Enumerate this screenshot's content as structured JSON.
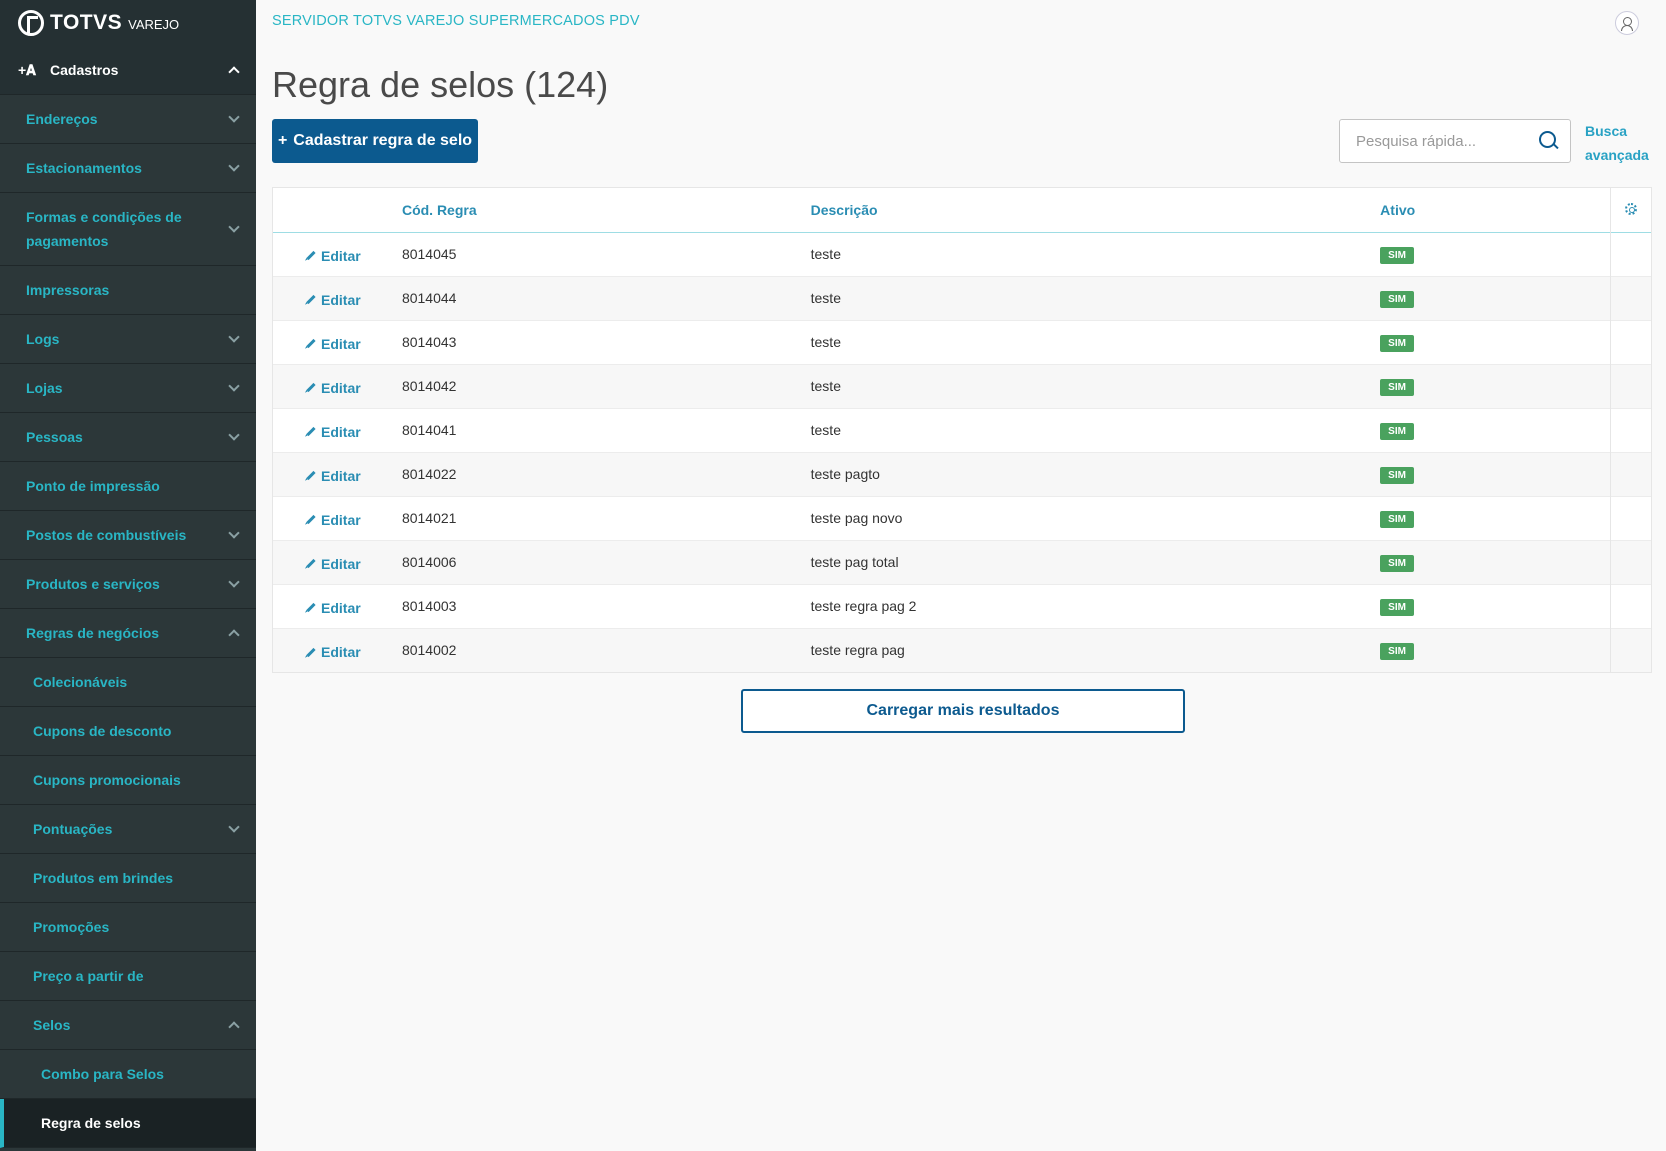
{
  "brand": {
    "name": "TOTVS",
    "product": "VAREJO"
  },
  "header": {
    "server_title": "SERVIDOR TOTVS VAREJO SUPERMERCADOS PDV"
  },
  "sidebar": {
    "section": "Cadastros",
    "items": [
      {
        "label": "Endereços"
      },
      {
        "label": "Estacionamentos"
      },
      {
        "label": "Formas e condições de pagamentos"
      },
      {
        "label": "Impressoras"
      },
      {
        "label": "Logs"
      },
      {
        "label": "Lojas"
      },
      {
        "label": "Pessoas"
      },
      {
        "label": "Ponto de impressão"
      },
      {
        "label": "Postos de combustíveis"
      },
      {
        "label": "Produtos e serviços"
      },
      {
        "label": "Regras de negócios"
      }
    ],
    "business_rules": [
      {
        "label": "Colecionáveis"
      },
      {
        "label": "Cupons de desconto"
      },
      {
        "label": "Cupons promocionais"
      },
      {
        "label": "Pontuações"
      },
      {
        "label": "Produtos em brindes"
      },
      {
        "label": "Promoções"
      },
      {
        "label": "Preço a partir de"
      },
      {
        "label": "Selos"
      }
    ],
    "selos": [
      {
        "label": "Combo para Selos"
      },
      {
        "label": "Regra de selos"
      }
    ]
  },
  "page": {
    "title": "Regra de selos (124)",
    "create_button": "Cadastrar regra de selo",
    "search_placeholder": "Pesquisa rápida...",
    "advanced_search": "Busca avançada",
    "load_more": "Carregar mais resultados"
  },
  "table": {
    "columns": [
      "Cód. Regra",
      "Descrição",
      "Ativo"
    ],
    "edit_label": "Editar",
    "rows": [
      {
        "code": "8014045",
        "description": "teste",
        "active": "SIM"
      },
      {
        "code": "8014044",
        "description": "teste",
        "active": "SIM"
      },
      {
        "code": "8014043",
        "description": "teste",
        "active": "SIM"
      },
      {
        "code": "8014042",
        "description": "teste",
        "active": "SIM"
      },
      {
        "code": "8014041",
        "description": "teste",
        "active": "SIM"
      },
      {
        "code": "8014022",
        "description": "teste pagto",
        "active": "SIM"
      },
      {
        "code": "8014021",
        "description": "teste pag novo",
        "active": "SIM"
      },
      {
        "code": "8014006",
        "description": "teste pag total",
        "active": "SIM"
      },
      {
        "code": "8014003",
        "description": "teste regra pag 2",
        "active": "SIM"
      },
      {
        "code": "8014002",
        "description": "teste regra pag",
        "active": "SIM"
      }
    ]
  },
  "colors": {
    "accent": "#29b6c5",
    "primary": "#0c5a8f",
    "sidebar_bg": "#2c3739",
    "badge_green": "#4aa25e"
  }
}
